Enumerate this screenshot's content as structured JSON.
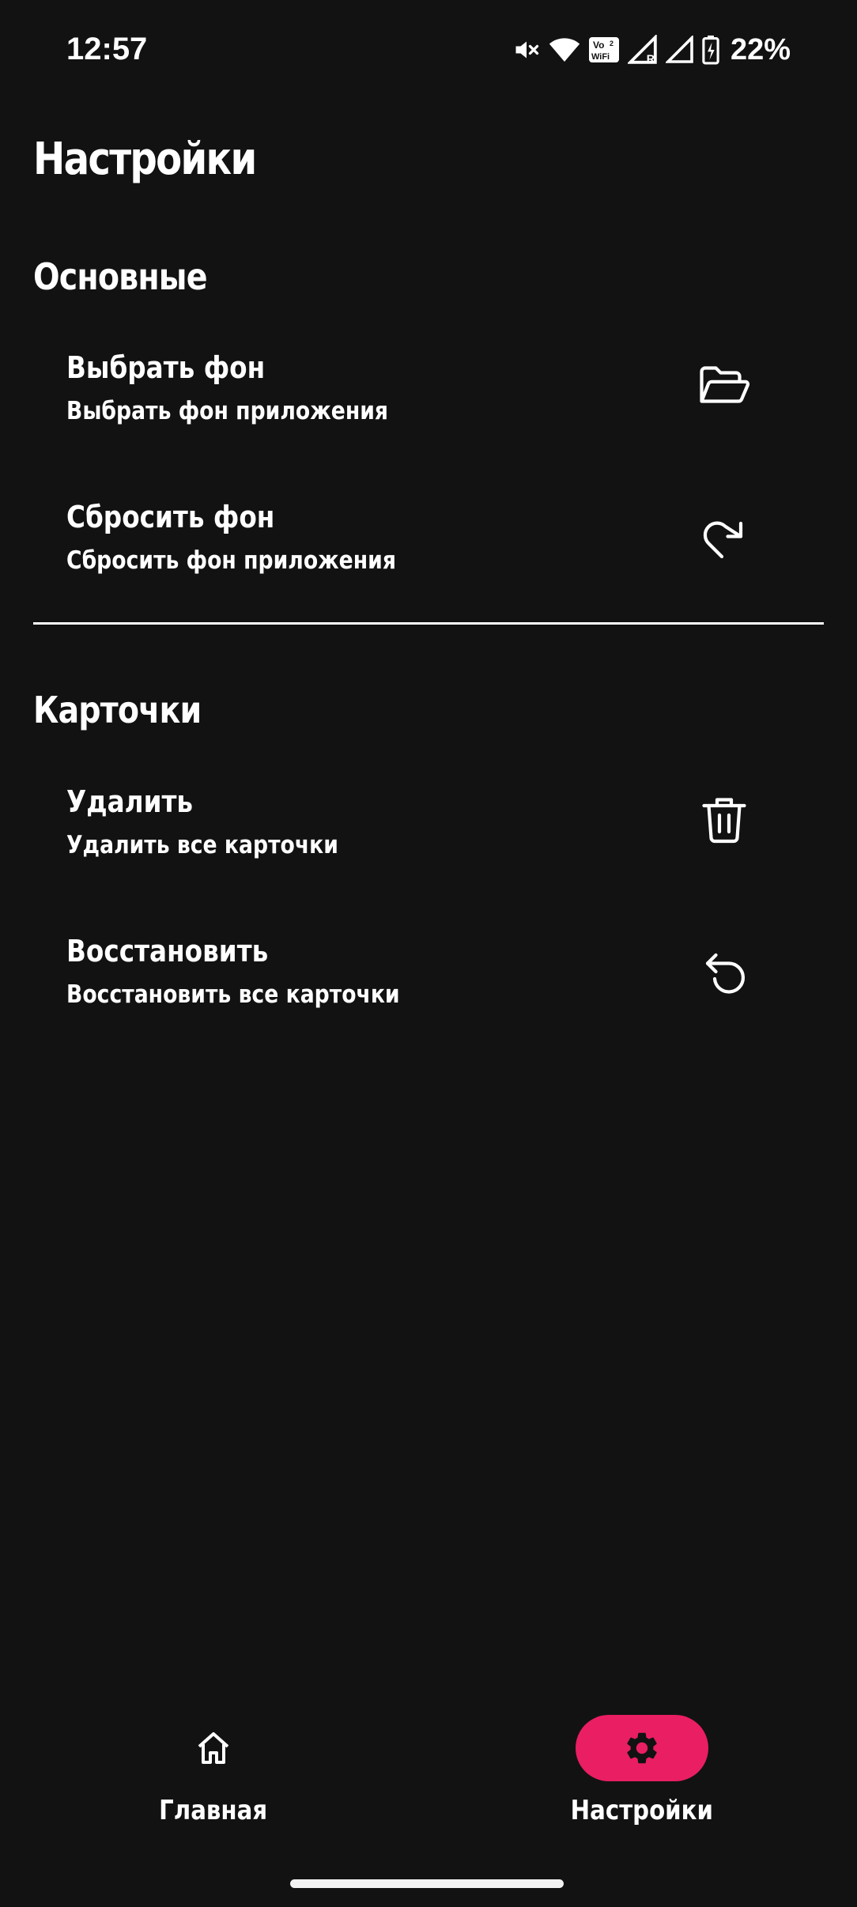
{
  "status_bar": {
    "time": "12:57",
    "battery_percent": "22%",
    "icons": [
      "mute-icon",
      "wifi-icon",
      "vowifi-icon",
      "signal-r-icon",
      "signal-icon",
      "battery-charging-icon"
    ],
    "vowifi_line1": "Vo",
    "vowifi_sup": "2",
    "vowifi_line2": "WiFi",
    "roaming_mark": "R"
  },
  "page": {
    "title": "Настройки"
  },
  "sections": [
    {
      "header": "Основные",
      "items": [
        {
          "title": "Выбрать фон",
          "subtitle": "Выбрать фон приложения",
          "icon": "folder-open-icon"
        },
        {
          "title": "Сбросить фон",
          "subtitle": "Сбросить фон приложения",
          "icon": "redo-icon"
        }
      ]
    },
    {
      "header": "Карточки",
      "items": [
        {
          "title": "Удалить",
          "subtitle": "Удалить все карточки",
          "icon": "trash-icon"
        },
        {
          "title": "Восстановить",
          "subtitle": "Восстановить все карточки",
          "icon": "undo-icon"
        }
      ]
    }
  ],
  "bottom_nav": {
    "items": [
      {
        "label": "Главная",
        "icon": "home-icon",
        "active": false
      },
      {
        "label": "Настройки",
        "icon": "gear-icon",
        "active": true
      }
    ]
  },
  "colors": {
    "background": "#121212",
    "text": "#ffffff",
    "accent": "#e91e63"
  }
}
